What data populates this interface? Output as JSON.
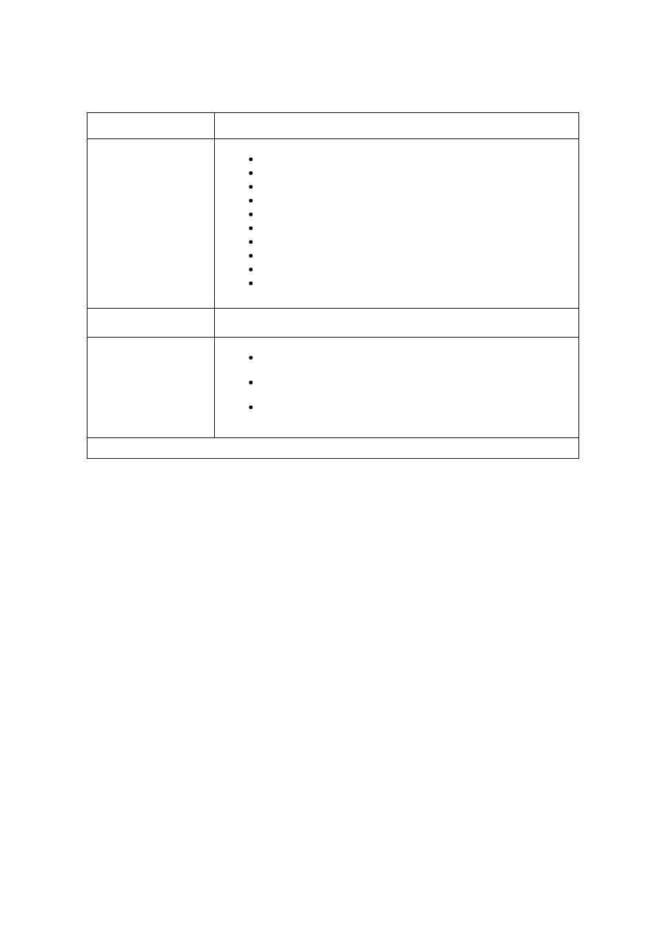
{
  "table": {
    "rows": [
      {
        "left": "",
        "right": ""
      },
      {
        "left": "",
        "bullets": [
          "",
          "",
          "",
          "",
          "",
          "",
          "",
          "",
          "",
          ""
        ]
      },
      {
        "left": "",
        "right": ""
      },
      {
        "left": "",
        "bullets": [
          "",
          "",
          ""
        ]
      },
      {
        "full": ""
      }
    ]
  }
}
